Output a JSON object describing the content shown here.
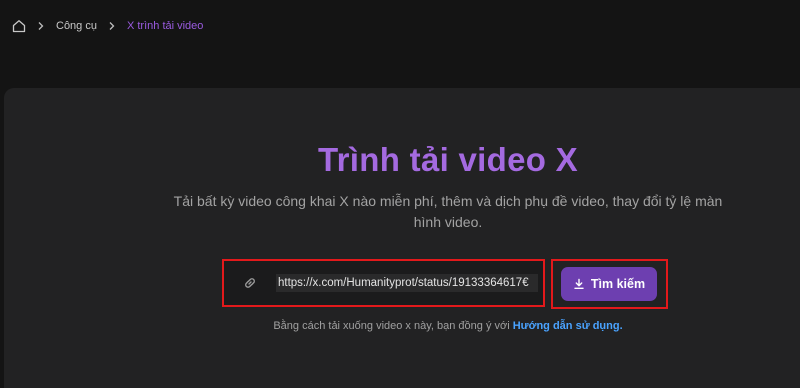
{
  "breadcrumb": {
    "items": [
      {
        "label": "Công cụ"
      },
      {
        "label": "X trình tải video"
      }
    ]
  },
  "hero": {
    "title": "Trình tải video X",
    "subtitle": "Tải bất kỳ video công khai X nào miễn phí, thêm và dịch phụ đề video, thay đổi tỷ lệ màn hình video."
  },
  "search": {
    "url_value": "https://x.com/Humanityprot/status/19133364617€",
    "button_label": "Tìm kiếm"
  },
  "terms": {
    "prefix": "Bằng cách tải xuống video x này, bạn đồng ý với ",
    "link_label": "Hướng dẫn sử dụng."
  },
  "colors": {
    "accent": "#a46ae0",
    "button": "#6d3fb0",
    "link": "#4aa3ff",
    "highlight_border": "#e3191b"
  },
  "icons": [
    "home-icon",
    "chevron-right-icon",
    "link-icon",
    "download-icon"
  ]
}
